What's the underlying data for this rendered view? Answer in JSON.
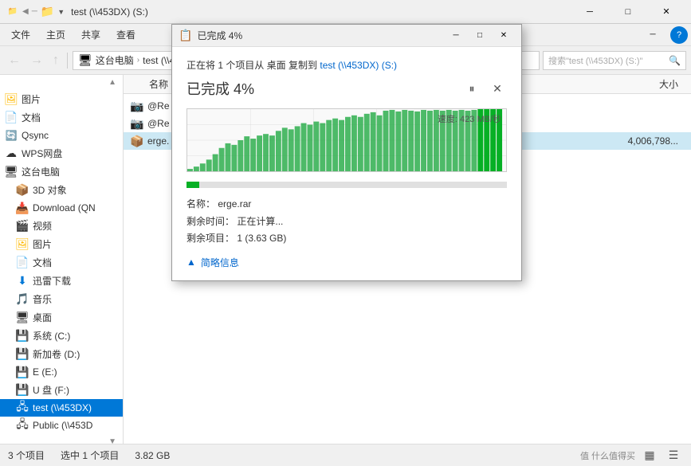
{
  "titlebar": {
    "icon": "📁",
    "title": "test (\\\\453DX) (S:)",
    "minimize": "─",
    "maximize": "□",
    "close": "✕"
  },
  "menubar": {
    "items": [
      "文件",
      "主页",
      "共享",
      "查看"
    ]
  },
  "toolbar": {
    "back": "←",
    "forward": "→",
    "up": "↑",
    "address_icon": "🖥",
    "address_parts": [
      "这台电脑",
      "test (\\\\453DX) (S:)"
    ],
    "search_placeholder": "搜索\"test (\\\\453DX) (S:)\""
  },
  "sidebar": {
    "top_arrow": "▲",
    "items": [
      {
        "icon": "🖼",
        "label": "图片",
        "type": "folder"
      },
      {
        "icon": "📄",
        "label": "文档",
        "type": "folder"
      },
      {
        "icon": "🔄",
        "label": "Qsync",
        "type": "app"
      },
      {
        "icon": "☁",
        "label": "WPS网盘",
        "type": "cloud"
      },
      {
        "icon": "🖥",
        "label": "这台电脑",
        "type": "computer",
        "expanded": true
      },
      {
        "icon": "📦",
        "label": "3D 对象",
        "type": "folder",
        "indent": true
      },
      {
        "icon": "📥",
        "label": "Download (QN",
        "type": "folder",
        "indent": true
      },
      {
        "icon": "🎬",
        "label": "视频",
        "type": "folder",
        "indent": true
      },
      {
        "icon": "🖼",
        "label": "图片",
        "type": "folder",
        "indent": true
      },
      {
        "icon": "📄",
        "label": "文档",
        "type": "folder",
        "indent": true
      },
      {
        "icon": "⬇",
        "label": "迅雷下载",
        "type": "folder",
        "indent": true
      },
      {
        "icon": "🎵",
        "label": "音乐",
        "type": "folder",
        "indent": true
      },
      {
        "icon": "🖥",
        "label": "桌面",
        "type": "folder",
        "indent": true
      },
      {
        "icon": "💾",
        "label": "系统 (C:)",
        "type": "drive",
        "indent": true
      },
      {
        "icon": "💾",
        "label": "新加卷 (D:)",
        "type": "drive",
        "indent": true
      },
      {
        "icon": "💾",
        "label": "E (E:)",
        "type": "drive",
        "indent": true
      },
      {
        "icon": "💾",
        "label": "U 盘 (F:)",
        "type": "drive",
        "indent": true
      },
      {
        "icon": "🖧",
        "label": "test (\\\\453DX)",
        "type": "network",
        "indent": true,
        "active": true
      },
      {
        "icon": "🖧",
        "label": "Public (\\\\453D",
        "type": "network",
        "indent": true
      }
    ],
    "bottom_arrow": "▼"
  },
  "content": {
    "columns": [
      "名称",
      "",
      "",
      "大小"
    ],
    "items": [
      {
        "icon": "📸",
        "name": "@Re",
        "size": ""
      },
      {
        "icon": "📸",
        "name": "@Re",
        "size": ""
      },
      {
        "icon": "📦",
        "name": "erge.",
        "size": "4,006,798...",
        "selected": true
      }
    ]
  },
  "statusbar": {
    "items_count": "3 个项目",
    "selected": "选中 1 个项目",
    "size": "3.82 GB",
    "watermark": "值 什么值得买",
    "view_icons": [
      "▦",
      "☰"
    ]
  },
  "copy_dialog": {
    "title_icon": "📋",
    "title_text": "已完成 4%",
    "minimize": "─",
    "maximize": "□",
    "close": "✕",
    "description": "正在将 1 个项目从 桌面 复制到 test (\\\\453DX) (S:)",
    "source_link": "test (\\\\453DX) (S:)",
    "progress_label": "已完成 4%",
    "pause_icon": "⏸",
    "cancel_icon": "✕",
    "speed_label": "速度: 423 MB/秒",
    "progress_percent": 4,
    "file_name_label": "名称：",
    "file_name": "erge.rar",
    "remaining_time_label": "剩余时间：",
    "remaining_time": "正在计算...",
    "remaining_items_label": "剩余项目：",
    "remaining_items": "1 (3.63 GB)",
    "details_toggle": "简略信息",
    "details_icon": "▲",
    "chart_bars": [
      2,
      5,
      8,
      12,
      18,
      25,
      30,
      28,
      35,
      40,
      38,
      42,
      45,
      43,
      50,
      55,
      52,
      58,
      62,
      60,
      65,
      63,
      68,
      70,
      67,
      72,
      75,
      73,
      78,
      80,
      76,
      82,
      85,
      83,
      88,
      90,
      87,
      85,
      88,
      90,
      88,
      85,
      88,
      90,
      88,
      88,
      90,
      88,
      90,
      92
    ]
  }
}
